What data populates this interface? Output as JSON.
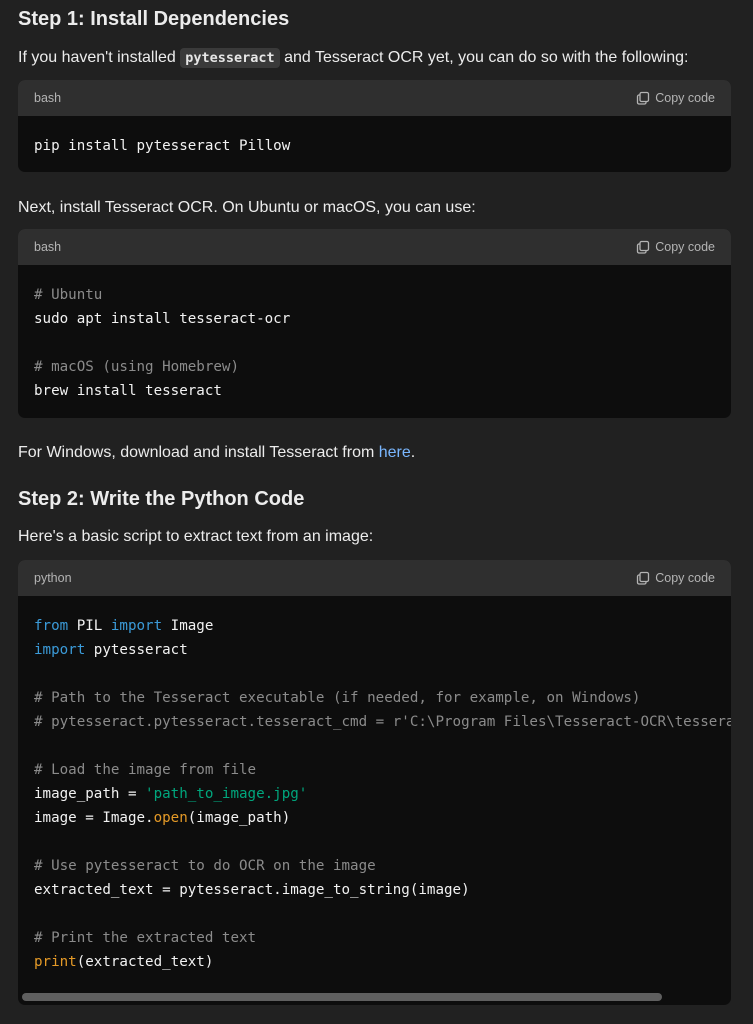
{
  "step1": {
    "heading": "Step 1: Install Dependencies",
    "intro_before": "If you haven't installed ",
    "intro_code": "pytesseract",
    "intro_after": " and Tesseract OCR yet, you can do so with the following:"
  },
  "block1": {
    "language": "bash",
    "copy_label": "Copy code",
    "lines": [
      [
        {
          "t": "pip install pytesseract Pillow",
          "k": "plain"
        }
      ]
    ]
  },
  "para_next": "Next, install Tesseract OCR. On Ubuntu or macOS, you can use:",
  "block2": {
    "language": "bash",
    "copy_label": "Copy code",
    "lines": [
      [
        {
          "t": "# Ubuntu",
          "k": "comment"
        }
      ],
      [
        {
          "t": "sudo apt install tesseract-ocr",
          "k": "plain"
        }
      ],
      [],
      [
        {
          "t": "# macOS (using Homebrew)",
          "k": "comment"
        }
      ],
      [
        {
          "t": "brew install tesseract",
          "k": "plain"
        }
      ]
    ]
  },
  "windows": {
    "before": "For Windows, download and install Tesseract from ",
    "link": "here",
    "after": "."
  },
  "step2": {
    "heading": "Step 2: Write the Python Code",
    "intro": "Here's a basic script to extract text from an image:"
  },
  "block3": {
    "language": "python",
    "copy_label": "Copy code",
    "lines": [
      [
        {
          "t": "from",
          "k": "kw"
        },
        {
          "t": " PIL ",
          "k": "plain"
        },
        {
          "t": "import",
          "k": "kw"
        },
        {
          "t": " Image",
          "k": "plain"
        }
      ],
      [
        {
          "t": "import",
          "k": "kw"
        },
        {
          "t": " pytesseract",
          "k": "plain"
        }
      ],
      [],
      [
        {
          "t": "# Path to the Tesseract executable (if needed, for example, on Windows)",
          "k": "comment"
        }
      ],
      [
        {
          "t": "# pytesseract.pytesseract.tesseract_cmd = r'C:\\Program Files\\Tesseract-OCR\\tesseract.exe'",
          "k": "comment"
        }
      ],
      [],
      [
        {
          "t": "# Load the image from file",
          "k": "comment"
        }
      ],
      [
        {
          "t": "image_path = ",
          "k": "plain"
        },
        {
          "t": "'path_to_image.jpg'",
          "k": "str"
        }
      ],
      [
        {
          "t": "image = Image.",
          "k": "plain"
        },
        {
          "t": "open",
          "k": "fn"
        },
        {
          "t": "(image_path)",
          "k": "plain"
        }
      ],
      [],
      [
        {
          "t": "# Use pytesseract to do OCR on the image",
          "k": "comment"
        }
      ],
      [
        {
          "t": "extracted_text = pytesseract.image_to_string(image)",
          "k": "plain"
        }
      ],
      [],
      [
        {
          "t": "# Print the extracted text",
          "k": "comment"
        }
      ],
      [
        {
          "t": "print",
          "k": "fn"
        },
        {
          "t": "(extracted_text)",
          "k": "plain"
        }
      ]
    ]
  },
  "colors": {
    "background": "#212121",
    "code_bg": "#0d0d0d",
    "header_bg": "#2f2f2f",
    "keyword": "#3b9bd9",
    "string": "#00a67d",
    "function": "#e59a27",
    "comment": "#8b8b8b",
    "link": "#7ab7ff"
  },
  "icons": {
    "copy": "copy-icon"
  }
}
